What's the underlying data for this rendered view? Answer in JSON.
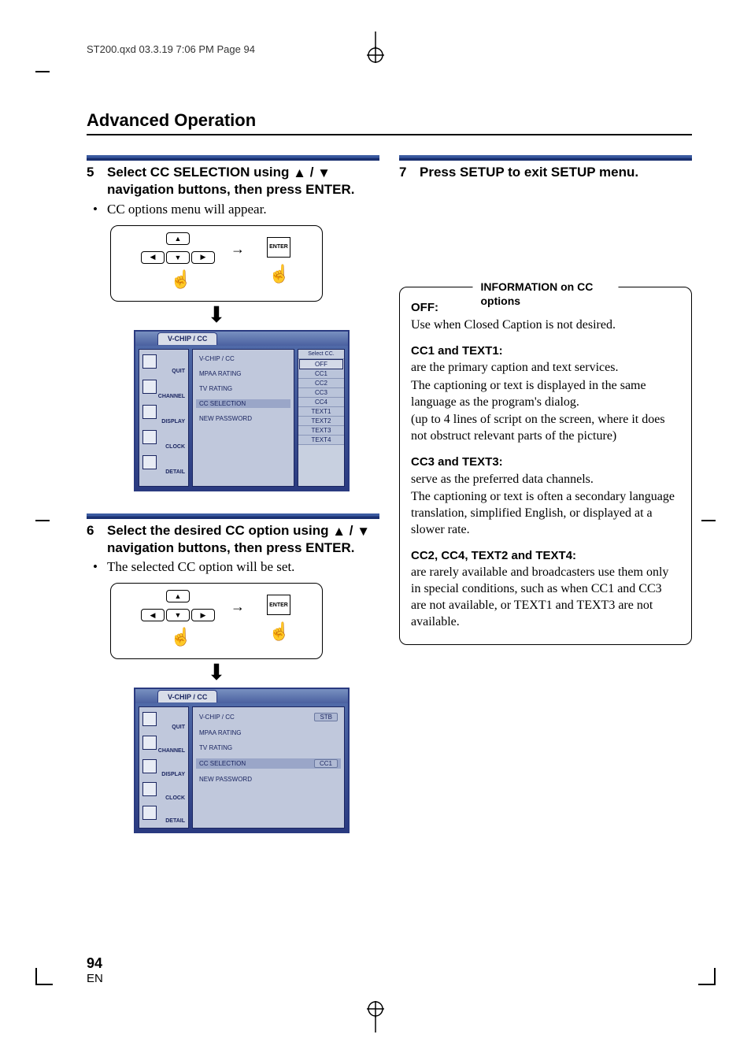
{
  "header": "ST200.qxd  03.3.19 7:06 PM  Page 94",
  "section_title": "Advanced Operation",
  "page_number": "94",
  "lang": "EN",
  "steps": {
    "s5": {
      "num": "5",
      "title_a": "Select CC SELECTION using ",
      "title_b": " / ",
      "title_c": " navigation buttons, then press ENTER."
    },
    "s5_note": "CC options menu will appear.",
    "s6": {
      "num": "6",
      "title_a": "Select  the desired CC option using ",
      "title_b": " / ",
      "title_c": " navigation buttons, then press ENTER."
    },
    "s6_note": "The selected CC option will be set.",
    "s7": {
      "num": "7",
      "title": "Press SETUP to exit SETUP menu."
    }
  },
  "remote": {
    "enter": "ENTER"
  },
  "osd": {
    "tab": "V-CHIP / CC",
    "side": [
      "QUIT",
      "CHANNEL",
      "DISPLAY",
      "CLOCK",
      "DETAIL"
    ],
    "menu": [
      "V-CHIP / CC",
      "MPAA RATING",
      "TV RATING",
      "CC SELECTION",
      "NEW PASSWORD"
    ],
    "sub_header": "Select CC.",
    "sub_items": [
      "OFF",
      "CC1",
      "CC2",
      "CC3",
      "CC4",
      "TEXT1",
      "TEXT2",
      "TEXT3",
      "TEXT4"
    ],
    "val_stb": "STB",
    "val_cc1": "CC1"
  },
  "info": {
    "title": "INFORMATION on  CC options",
    "off_h": "OFF:",
    "off_t": "Use when Closed Caption is not desired.",
    "cc1_h": "CC1 and TEXT1:",
    "cc1_t1": "are the primary caption and text services.",
    "cc1_t2": "The captioning or text is displayed in the same language as the program's dialog.",
    "cc1_t3": "(up to 4 lines of script on the screen, where it does not obstruct relevant parts of the picture)",
    "cc3_h": "CC3 and TEXT3:",
    "cc3_t1": "serve as the preferred data channels.",
    "cc3_t2": "The captioning or text is often a secondary language translation, simplified English, or displayed at a slower rate.",
    "cc2_h": "CC2, CC4, TEXT2 and TEXT4:",
    "cc2_t1": "are rarely available and broadcasters use them only in special conditions, such as when CC1 and CC3 are not available, or TEXT1 and TEXT3 are not available."
  }
}
